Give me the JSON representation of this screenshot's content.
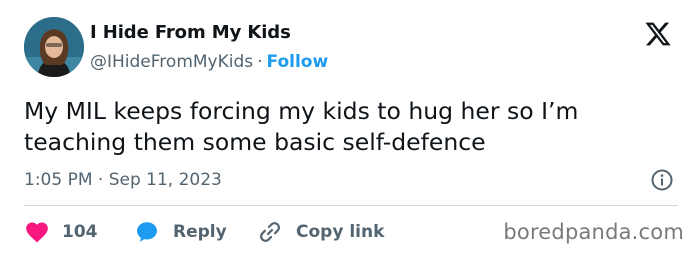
{
  "author": {
    "display_name": "I Hide From My Kids",
    "handle": "@IHideFromMyKids",
    "separator": "·",
    "follow_label": "Follow"
  },
  "tweet": {
    "text": "My MIL keeps forcing my kids to hug her so I’m teaching them some basic self-defence",
    "time": "1:05 PM",
    "separator": "·",
    "date": "Sep 11, 2023"
  },
  "actions": {
    "like_count": "104",
    "reply_label": "Reply",
    "copy_label": "Copy link"
  },
  "watermark": "boredpanda.com",
  "icons": {
    "logo": "x-logo-icon",
    "info": "info-icon",
    "like": "heart-icon",
    "reply": "speech-bubble-icon",
    "copy": "link-icon"
  },
  "colors": {
    "accent": "#1d9bf0",
    "like": "#f91880",
    "muted": "#536471",
    "text": "#0f1419"
  }
}
